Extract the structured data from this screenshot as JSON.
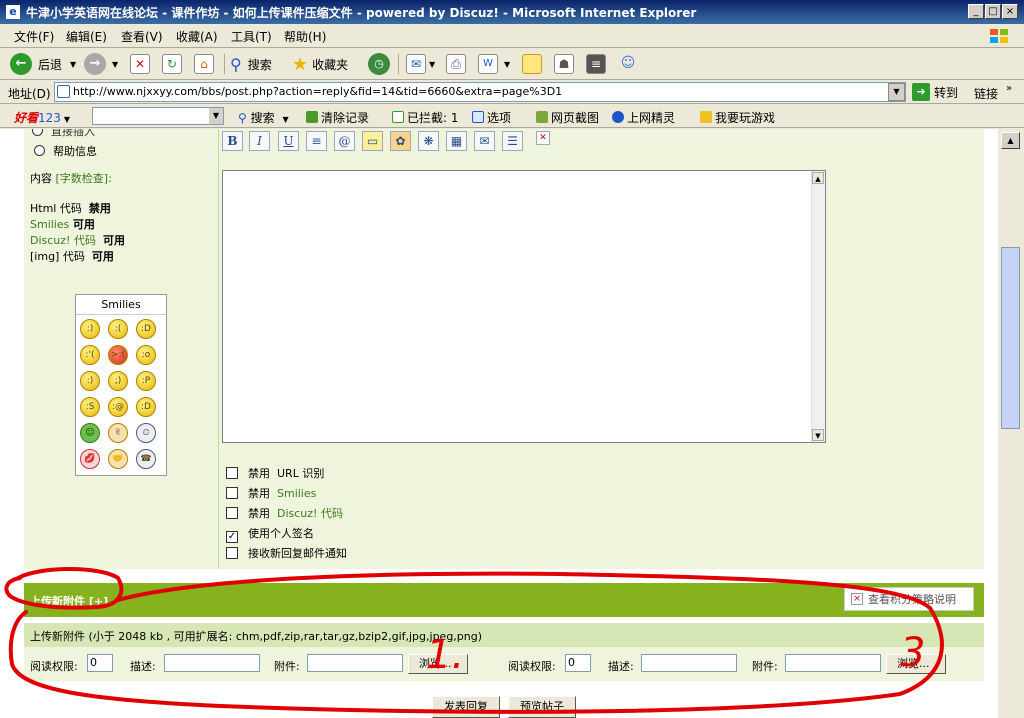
{
  "window": {
    "title": "牛津小学英语网在线论坛 - 课件作坊 - 如何上传课件压缩文件 - powered by Discuz! - Microsoft Internet Explorer",
    "buttons": [
      "_",
      "□",
      "×"
    ]
  },
  "menubar": {
    "items": [
      "文件(F)",
      "编辑(E)",
      "查看(V)",
      "收藏(A)",
      "工具(T)",
      "帮助(H)"
    ]
  },
  "toolbar": {
    "back": "后退",
    "search": "搜索",
    "favorites": "收藏夹",
    "icons": [
      "back-icon",
      "forward-icon",
      "stop-icon",
      "refresh-icon",
      "home-icon",
      "search-icon",
      "favorites-icon",
      "history-icon",
      "mail-icon",
      "print-icon",
      "edit-icon",
      "notes-icon",
      "messenger-icon",
      "media-icon",
      "users-icon"
    ]
  },
  "addressbar": {
    "label": "地址(D)",
    "url": "http://www.njxxyy.com/bbs/post.php?action=reply&fid=14&tid=6660&extra=page%3D1",
    "go": "转到",
    "links": "链接"
  },
  "searchbar": {
    "logo_a": "好看",
    "logo_b": "123",
    "search": "搜索",
    "clear": "清除记录",
    "blocked": "已拦截: 1",
    "options": "选项",
    "screenshot": "网页截图",
    "wizard": "上网精灵",
    "games": "我要玩游戏"
  },
  "form": {
    "radio_partial": "直接插入",
    "help": "帮助信息",
    "content_label": "内容",
    "word_check": "[字数检查]:",
    "html_code": "Html 代码",
    "html_state": "禁用",
    "smilies": "Smilies",
    "smilies_state": "可用",
    "discuz_code": "Discuz! 代码",
    "discuz_state": "可用",
    "img_code": "[img] 代码",
    "img_state": "可用",
    "smilies_title": "Smilies",
    "smiley_faces": [
      ":)",
      ":(",
      ":D",
      ":'(",
      ">:(",
      ":o",
      ":)",
      ";)",
      ":P",
      ":S",
      ":@",
      ":D",
      "☺",
      "✌",
      "⏲",
      "💋",
      "🤝",
      "☎"
    ],
    "editor_buttons": [
      "B",
      "I",
      "U",
      "≡",
      "@",
      "▭",
      "✿",
      "❋",
      "▦",
      "✉",
      "☰",
      "✕"
    ],
    "disable_label": "禁用",
    "url_detect": "URL 识别",
    "disable_smilies": "Smilies",
    "disable_discuz": "Discuz! 代码",
    "signature": "使用个人签名",
    "notify": "接收新回复邮件通知",
    "signature_checked": true
  },
  "attach": {
    "header": "上传新附件 [+]",
    "points": "查看积分策略说明",
    "info": "上传新附件 (小于  2048 kb , 可用扩展名: chm,pdf,zip,rar,tar,gz,bzip2,gif,jpg,jpeg,png)",
    "read_perm": "阅读权限:",
    "read_value": "0",
    "desc": "描述:",
    "file": "附件:",
    "browse": "浏览..."
  },
  "buttons": {
    "reply": "发表回复",
    "preview": "预览帖子"
  },
  "annotations": {
    "num1": "1.",
    "num3": "3",
    "color": "#e00000"
  }
}
